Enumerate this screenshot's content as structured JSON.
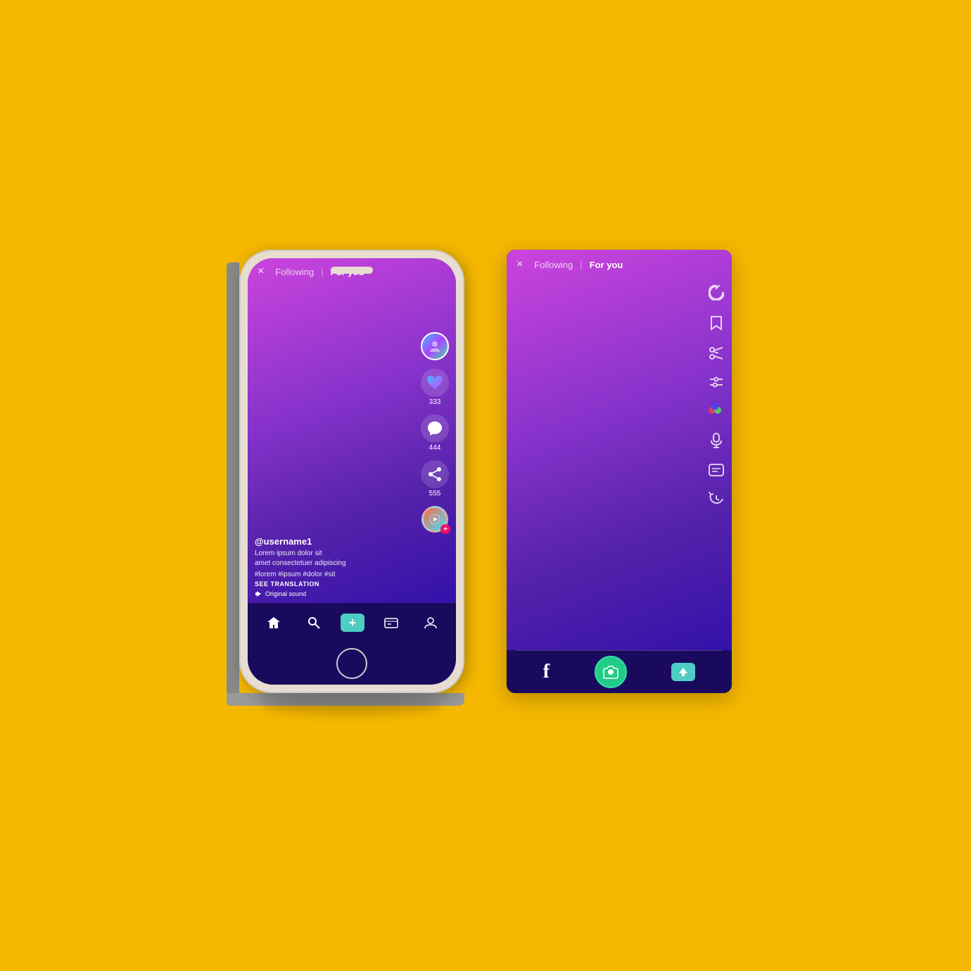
{
  "background": "#F5B800",
  "phone1": {
    "nav": {
      "close_label": "×",
      "following_label": "Following",
      "separator": "|",
      "foryou_label": "For you"
    },
    "side_icons": {
      "like_count": "333",
      "comment_count": "444",
      "share_count": "555"
    },
    "content": {
      "username": "@username1",
      "caption_line1": "Lorem ipsum dolor sit",
      "caption_line2": "amet consectetuer adipiscing",
      "hashtags": "#lorem #ipsum #dolor #sit",
      "see_translation": "SEE TRANSLATION",
      "sound_label": "Original sound"
    },
    "bottom_nav": {
      "home": "⌂",
      "search": "🔍",
      "plus": "+",
      "inbox": "☰",
      "profile": "👤"
    }
  },
  "phone2": {
    "nav": {
      "close_label": "×",
      "following_label": "Following",
      "separator": "|",
      "foryou_label": "For you"
    },
    "side_icons": [
      "↺",
      "🔖",
      "✂",
      "⚡",
      "⬡",
      "🎤",
      "◻",
      "⟳"
    ],
    "bottom_nav": {
      "facebook": "f",
      "camera": "●",
      "upload": "↑"
    }
  }
}
